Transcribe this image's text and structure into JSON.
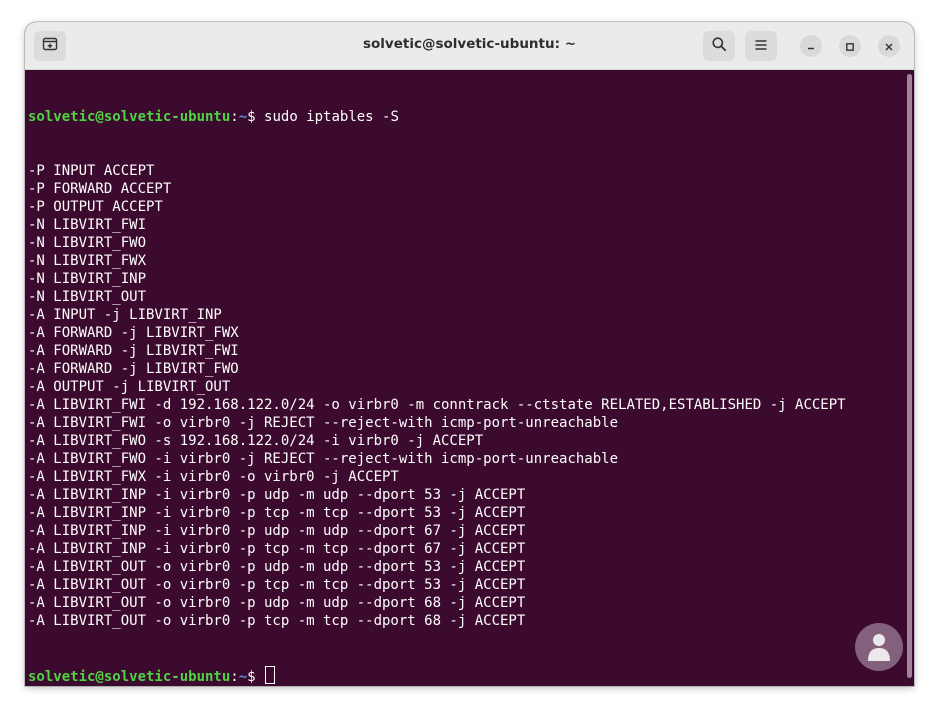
{
  "window": {
    "title": "solvetic@solvetic-ubuntu: ~"
  },
  "icons": {
    "new_tab": "new-tab-icon",
    "search": "search-icon",
    "menu": "hamburger-menu-icon",
    "minimize": "minimize-icon",
    "maximize": "maximize-icon",
    "close": "close-icon",
    "watermark": "person-logo-icon"
  },
  "colors": {
    "terminal_bg": "#3c0a2e",
    "prompt_user": "#4fd343",
    "prompt_path": "#5f8fd8",
    "text": "#ffffff"
  },
  "terminal": {
    "prompt_user": "solvetic@solvetic-ubuntu",
    "prompt_sep": ":",
    "prompt_path": "~",
    "prompt_symbol": "$ ",
    "command": "sudo iptables -S",
    "output": [
      "-P INPUT ACCEPT",
      "-P FORWARD ACCEPT",
      "-P OUTPUT ACCEPT",
      "-N LIBVIRT_FWI",
      "-N LIBVIRT_FWO",
      "-N LIBVIRT_FWX",
      "-N LIBVIRT_INP",
      "-N LIBVIRT_OUT",
      "-A INPUT -j LIBVIRT_INP",
      "-A FORWARD -j LIBVIRT_FWX",
      "-A FORWARD -j LIBVIRT_FWI",
      "-A FORWARD -j LIBVIRT_FWO",
      "-A OUTPUT -j LIBVIRT_OUT",
      "-A LIBVIRT_FWI -d 192.168.122.0/24 -o virbr0 -m conntrack --ctstate RELATED,ESTABLISHED -j ACCEPT",
      "-A LIBVIRT_FWI -o virbr0 -j REJECT --reject-with icmp-port-unreachable",
      "-A LIBVIRT_FWO -s 192.168.122.0/24 -i virbr0 -j ACCEPT",
      "-A LIBVIRT_FWO -i virbr0 -j REJECT --reject-with icmp-port-unreachable",
      "-A LIBVIRT_FWX -i virbr0 -o virbr0 -j ACCEPT",
      "-A LIBVIRT_INP -i virbr0 -p udp -m udp --dport 53 -j ACCEPT",
      "-A LIBVIRT_INP -i virbr0 -p tcp -m tcp --dport 53 -j ACCEPT",
      "-A LIBVIRT_INP -i virbr0 -p udp -m udp --dport 67 -j ACCEPT",
      "-A LIBVIRT_INP -i virbr0 -p tcp -m tcp --dport 67 -j ACCEPT",
      "-A LIBVIRT_OUT -o virbr0 -p udp -m udp --dport 53 -j ACCEPT",
      "-A LIBVIRT_OUT -o virbr0 -p tcp -m tcp --dport 53 -j ACCEPT",
      "-A LIBVIRT_OUT -o virbr0 -p udp -m udp --dport 68 -j ACCEPT",
      "-A LIBVIRT_OUT -o virbr0 -p tcp -m tcp --dport 68 -j ACCEPT"
    ]
  }
}
